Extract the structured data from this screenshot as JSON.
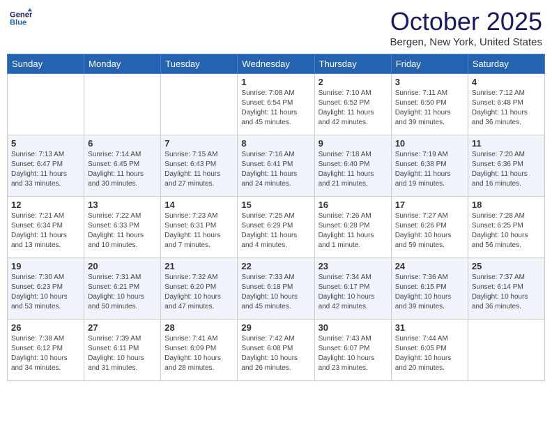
{
  "header": {
    "logo_line1": "General",
    "logo_line2": "Blue",
    "month": "October 2025",
    "location": "Bergen, New York, United States"
  },
  "weekdays": [
    "Sunday",
    "Monday",
    "Tuesday",
    "Wednesday",
    "Thursday",
    "Friday",
    "Saturday"
  ],
  "weeks": [
    [
      {
        "day": "",
        "info": ""
      },
      {
        "day": "",
        "info": ""
      },
      {
        "day": "",
        "info": ""
      },
      {
        "day": "1",
        "info": "Sunrise: 7:08 AM\nSunset: 6:54 PM\nDaylight: 11 hours and 45 minutes."
      },
      {
        "day": "2",
        "info": "Sunrise: 7:10 AM\nSunset: 6:52 PM\nDaylight: 11 hours and 42 minutes."
      },
      {
        "day": "3",
        "info": "Sunrise: 7:11 AM\nSunset: 6:50 PM\nDaylight: 11 hours and 39 minutes."
      },
      {
        "day": "4",
        "info": "Sunrise: 7:12 AM\nSunset: 6:48 PM\nDaylight: 11 hours and 36 minutes."
      }
    ],
    [
      {
        "day": "5",
        "info": "Sunrise: 7:13 AM\nSunset: 6:47 PM\nDaylight: 11 hours and 33 minutes."
      },
      {
        "day": "6",
        "info": "Sunrise: 7:14 AM\nSunset: 6:45 PM\nDaylight: 11 hours and 30 minutes."
      },
      {
        "day": "7",
        "info": "Sunrise: 7:15 AM\nSunset: 6:43 PM\nDaylight: 11 hours and 27 minutes."
      },
      {
        "day": "8",
        "info": "Sunrise: 7:16 AM\nSunset: 6:41 PM\nDaylight: 11 hours and 24 minutes."
      },
      {
        "day": "9",
        "info": "Sunrise: 7:18 AM\nSunset: 6:40 PM\nDaylight: 11 hours and 21 minutes."
      },
      {
        "day": "10",
        "info": "Sunrise: 7:19 AM\nSunset: 6:38 PM\nDaylight: 11 hours and 19 minutes."
      },
      {
        "day": "11",
        "info": "Sunrise: 7:20 AM\nSunset: 6:36 PM\nDaylight: 11 hours and 16 minutes."
      }
    ],
    [
      {
        "day": "12",
        "info": "Sunrise: 7:21 AM\nSunset: 6:34 PM\nDaylight: 11 hours and 13 minutes."
      },
      {
        "day": "13",
        "info": "Sunrise: 7:22 AM\nSunset: 6:33 PM\nDaylight: 11 hours and 10 minutes."
      },
      {
        "day": "14",
        "info": "Sunrise: 7:23 AM\nSunset: 6:31 PM\nDaylight: 11 hours and 7 minutes."
      },
      {
        "day": "15",
        "info": "Sunrise: 7:25 AM\nSunset: 6:29 PM\nDaylight: 11 hours and 4 minutes."
      },
      {
        "day": "16",
        "info": "Sunrise: 7:26 AM\nSunset: 6:28 PM\nDaylight: 11 hours and 1 minute."
      },
      {
        "day": "17",
        "info": "Sunrise: 7:27 AM\nSunset: 6:26 PM\nDaylight: 10 hours and 59 minutes."
      },
      {
        "day": "18",
        "info": "Sunrise: 7:28 AM\nSunset: 6:25 PM\nDaylight: 10 hours and 56 minutes."
      }
    ],
    [
      {
        "day": "19",
        "info": "Sunrise: 7:30 AM\nSunset: 6:23 PM\nDaylight: 10 hours and 53 minutes."
      },
      {
        "day": "20",
        "info": "Sunrise: 7:31 AM\nSunset: 6:21 PM\nDaylight: 10 hours and 50 minutes."
      },
      {
        "day": "21",
        "info": "Sunrise: 7:32 AM\nSunset: 6:20 PM\nDaylight: 10 hours and 47 minutes."
      },
      {
        "day": "22",
        "info": "Sunrise: 7:33 AM\nSunset: 6:18 PM\nDaylight: 10 hours and 45 minutes."
      },
      {
        "day": "23",
        "info": "Sunrise: 7:34 AM\nSunset: 6:17 PM\nDaylight: 10 hours and 42 minutes."
      },
      {
        "day": "24",
        "info": "Sunrise: 7:36 AM\nSunset: 6:15 PM\nDaylight: 10 hours and 39 minutes."
      },
      {
        "day": "25",
        "info": "Sunrise: 7:37 AM\nSunset: 6:14 PM\nDaylight: 10 hours and 36 minutes."
      }
    ],
    [
      {
        "day": "26",
        "info": "Sunrise: 7:38 AM\nSunset: 6:12 PM\nDaylight: 10 hours and 34 minutes."
      },
      {
        "day": "27",
        "info": "Sunrise: 7:39 AM\nSunset: 6:11 PM\nDaylight: 10 hours and 31 minutes."
      },
      {
        "day": "28",
        "info": "Sunrise: 7:41 AM\nSunset: 6:09 PM\nDaylight: 10 hours and 28 minutes."
      },
      {
        "day": "29",
        "info": "Sunrise: 7:42 AM\nSunset: 6:08 PM\nDaylight: 10 hours and 26 minutes."
      },
      {
        "day": "30",
        "info": "Sunrise: 7:43 AM\nSunset: 6:07 PM\nDaylight: 10 hours and 23 minutes."
      },
      {
        "day": "31",
        "info": "Sunrise: 7:44 AM\nSunset: 6:05 PM\nDaylight: 10 hours and 20 minutes."
      },
      {
        "day": "",
        "info": ""
      }
    ]
  ]
}
